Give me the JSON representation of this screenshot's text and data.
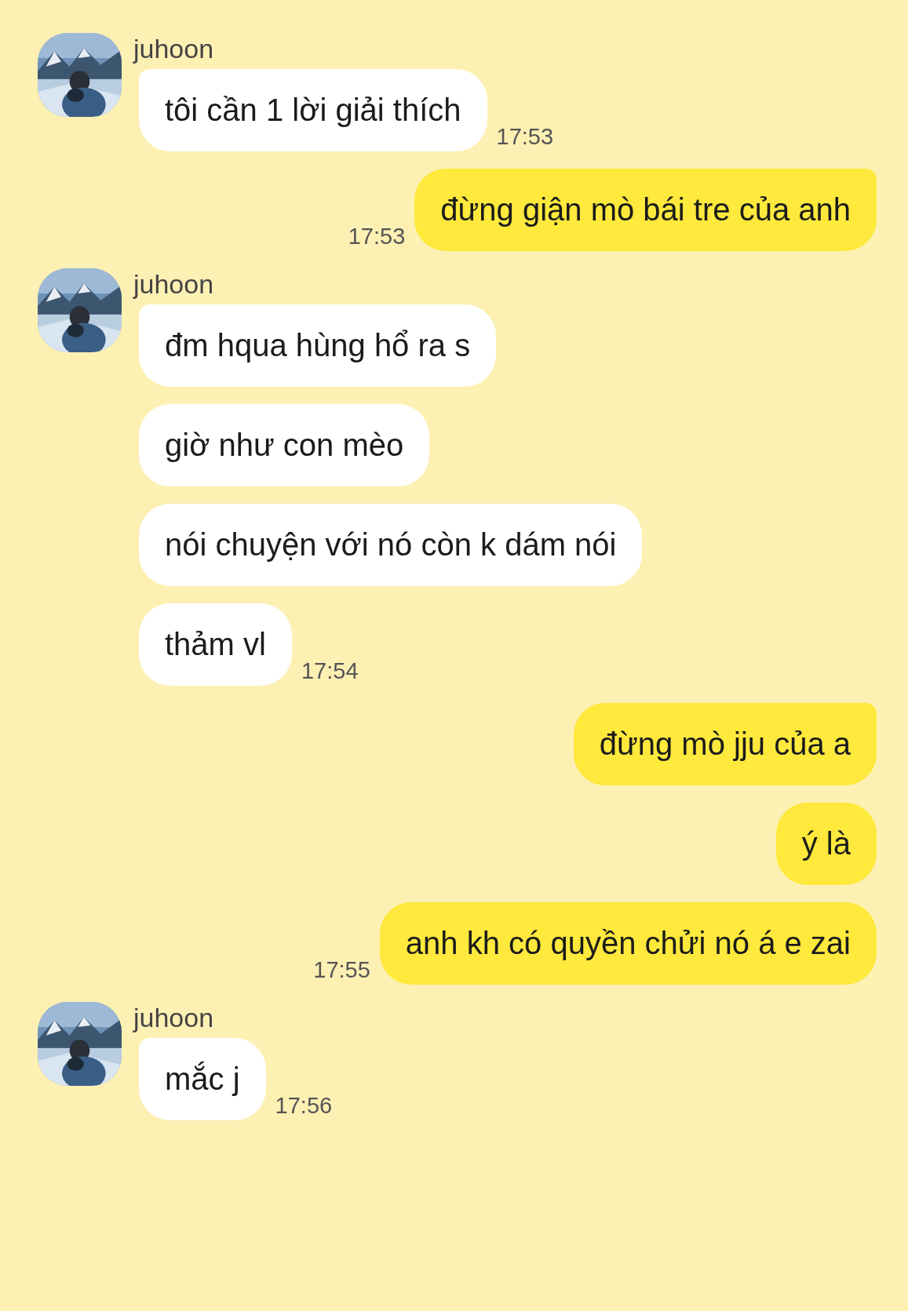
{
  "groups": [
    {
      "kind": "incoming",
      "sender": "juhoon",
      "messages": [
        {
          "text": "tôi cần 1 lời giải thích"
        }
      ],
      "time": "17:53"
    },
    {
      "kind": "outgoing",
      "messages": [
        {
          "text": "đừng giận mò bái tre của anh"
        }
      ],
      "time": "17:53"
    },
    {
      "kind": "incoming",
      "sender": "juhoon",
      "messages": [
        {
          "text": "đm hqua hùng hổ ra s"
        },
        {
          "text": "giờ như con mèo"
        },
        {
          "text": "nói chuyện với nó còn k dám nói"
        },
        {
          "text": "thảm vl"
        }
      ],
      "time": "17:54"
    },
    {
      "kind": "outgoing",
      "messages": [
        {
          "text": "đừng mò jju của a"
        },
        {
          "text": "ý là"
        },
        {
          "text": "anh kh có quyền chửi nó á e zai"
        }
      ],
      "time": "17:55"
    },
    {
      "kind": "incoming",
      "sender": "juhoon",
      "messages": [
        {
          "text": "mắc j"
        }
      ],
      "time": "17:56"
    }
  ]
}
